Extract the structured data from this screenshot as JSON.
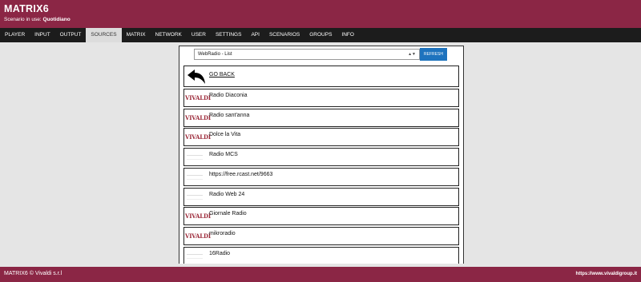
{
  "header": {
    "title": "MATRIX6",
    "scenario_label": "Scenario in use:",
    "scenario_value": "Quotidiano"
  },
  "nav": {
    "items": [
      {
        "label": "PLAYER",
        "active": false
      },
      {
        "label": "INPUT",
        "active": false
      },
      {
        "label": "OUTPUT",
        "active": false
      },
      {
        "label": "SOURCES",
        "active": true
      },
      {
        "label": "MATRIX",
        "active": false
      },
      {
        "label": "NETWORK",
        "active": false
      },
      {
        "label": "USER",
        "active": false
      },
      {
        "label": "SETTINGS",
        "active": false
      },
      {
        "label": "API",
        "active": false
      },
      {
        "label": "SCENARIOS",
        "active": false
      },
      {
        "label": "GROUPS",
        "active": false
      },
      {
        "label": "INFO",
        "active": false
      }
    ]
  },
  "source_select": {
    "value": "WebRadio - List",
    "refresh_label": "REFRESH"
  },
  "list": {
    "go_back_label": "GO BACK",
    "logo_text": "VIVALDI",
    "stations": [
      {
        "name": "Radio Diaconia",
        "icon": "vivaldi-logo"
      },
      {
        "name": "Radio sant'anna",
        "icon": "vivaldi-logo"
      },
      {
        "name": "Dolce la Vita",
        "icon": "vivaldi-logo"
      },
      {
        "name": "Radio MCS",
        "icon": "placeholder"
      },
      {
        "name": "https://free.rcast.net/9663",
        "icon": "placeholder"
      },
      {
        "name": "Radio Web 24",
        "icon": "placeholder"
      },
      {
        "name": "Giornale Radio",
        "icon": "vivaldi-logo"
      },
      {
        "name": "mikroradio",
        "icon": "vivaldi-logo"
      },
      {
        "name": "16Radio",
        "icon": "placeholder"
      }
    ]
  },
  "footer": {
    "copyright": "MATRIX6 © Vivaldi s.r.l",
    "website": "https://www.vivaldigroup.it"
  },
  "colors": {
    "brand": "#8b2645",
    "nav_bg": "#1c1c1c",
    "button": "#1e73be"
  }
}
